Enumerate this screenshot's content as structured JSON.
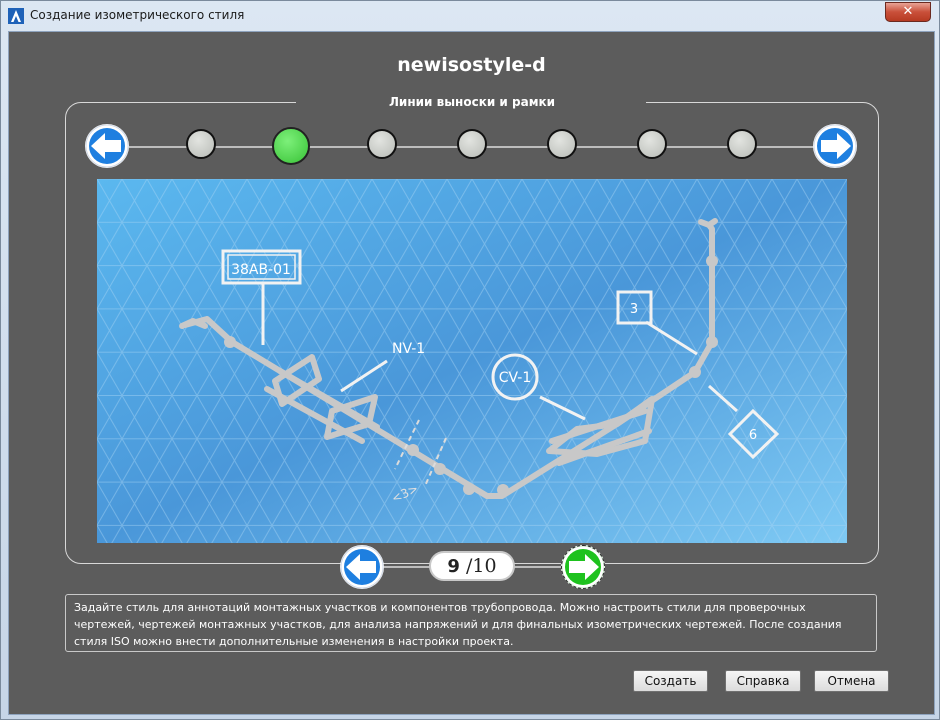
{
  "window": {
    "title": "Создание изометрического стиля",
    "close_label": "✕"
  },
  "header": {
    "style_name": "newisostyle-d",
    "section_title": "Линии выноски и рамки"
  },
  "steps": {
    "count": 8,
    "active_index": 2
  },
  "preview": {
    "labels": {
      "tag_line": "38AB-01",
      "valve_tag": "NV-1",
      "control_valve": "CV-1",
      "box_label": "3",
      "diamond_label": "6",
      "dimension": "3"
    }
  },
  "pager": {
    "current": "9",
    "total": "/10"
  },
  "description": "Задайте стиль для аннотаций монтажных участков и компонентов трубопровода. Можно настроить стили для проверочных чертежей, чертежей монтажных участков, для анализа напряжений и для финальных изометрических чертежей. После создания стиля ISO можно внести дополнительные изменения в настройки проекта.",
  "buttons": {
    "create": "Создать",
    "help": "Справка",
    "cancel": "Отмена"
  },
  "colors": {
    "background": "#5c5c5c",
    "active_step": "#4ee04b",
    "nav_arrow": "#1e7fe0",
    "next_arrow_green": "#1ec21e"
  },
  "icons": {
    "app": "autocad-plant3d-icon",
    "prev": "arrow-left-icon",
    "next": "arrow-right-icon"
  }
}
